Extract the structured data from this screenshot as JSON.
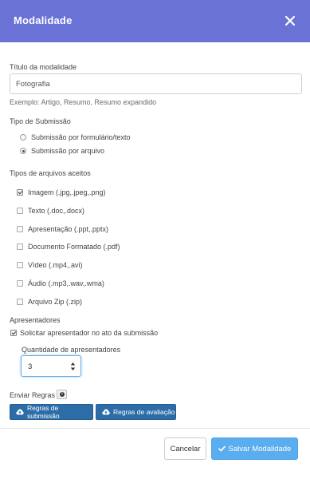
{
  "header": {
    "title": "Modalidade",
    "close_icon": "close-icon"
  },
  "titulo": {
    "label": "Título da modalidade",
    "value": "Fotografia",
    "help": "Exemplo: Artigo, Resumo, Resumo expandido"
  },
  "submissao": {
    "label": "Tipo de Submissão",
    "options": [
      {
        "label": "Submissão por formulário/texto",
        "selected": false
      },
      {
        "label": "Submissão por arquivo",
        "selected": true
      }
    ]
  },
  "tipos": {
    "label": "Tipos de arquivos aceitos",
    "options": [
      {
        "label": "Imagem (.jpg,.jpeg,.png)",
        "checked": true
      },
      {
        "label": "Texto (.doc,.docx)",
        "checked": false
      },
      {
        "label": "Apresentação (.ppt,.pptx)",
        "checked": false
      },
      {
        "label": "Documento Formatado (.pdf)",
        "checked": false
      },
      {
        "label": "Vídeo (.mp4,.avi)",
        "checked": false
      },
      {
        "label": "Áudio (.mp3,.wav,.wma)",
        "checked": false
      },
      {
        "label": "Arquivo Zip (.zip)",
        "checked": false
      }
    ]
  },
  "apresentadores": {
    "label": "Apresentadores",
    "check_label": "Solicitar apresentador no ato da submissão",
    "checked": true,
    "quantidade_label": "Quantidade de apresentadores",
    "quantidade_value": "3"
  },
  "regras": {
    "label": "Enviar Regras",
    "info_icon": "info-icon",
    "submissao_label": "Regras de submissão",
    "avaliacao_label": "Regras de avaliação"
  },
  "footer": {
    "cancel_label": "Cancelar",
    "save_label": "Salvar Modalidade"
  },
  "colors": {
    "header": "#6a72d6",
    "rules_button": "#2c6da8",
    "save_button": "#5aaef0"
  }
}
